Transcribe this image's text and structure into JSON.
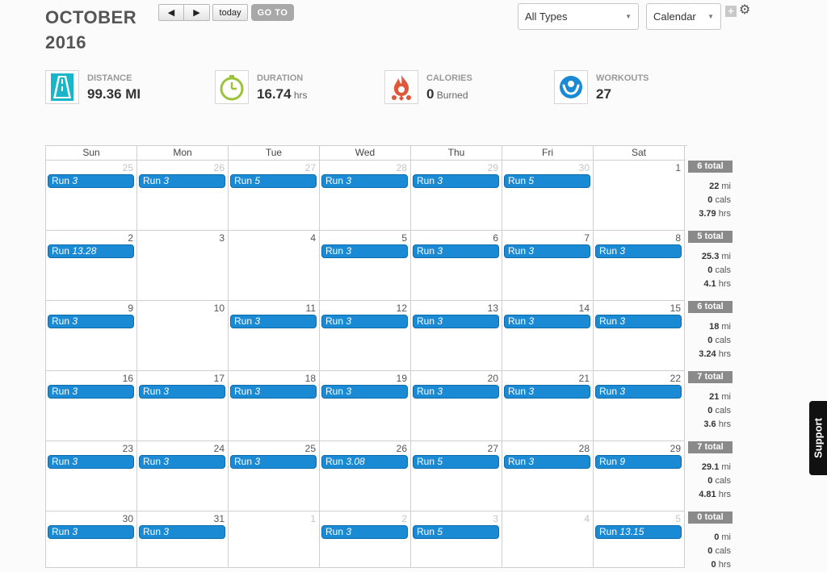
{
  "header": {
    "month": "OCTOBER",
    "year": "2016",
    "prev_label": "◀",
    "next_label": "▶",
    "today_label": "today",
    "goto_label": "GO TO",
    "types_select": "All Types",
    "view_select": "Calendar",
    "plus_icon": "plus-icon",
    "settings_icon": "gear-icon"
  },
  "stats": [
    {
      "label": "DISTANCE",
      "value": "99.36 MI",
      "unit": "",
      "icon": "road-icon",
      "color": "#1ab5c8"
    },
    {
      "label": "DURATION",
      "value": "16.74",
      "unit": " hrs",
      "icon": "stopwatch-icon",
      "color": "#9bc43a"
    },
    {
      "label": "CALORIES",
      "value": "0",
      "unit": " Burned",
      "icon": "flame-icon",
      "color": "#e0583a"
    },
    {
      "label": "WORKOUTS",
      "value": "27",
      "unit": "",
      "icon": "person-icon",
      "color": "#1a8ad4"
    }
  ],
  "calendar": {
    "days_of_week": [
      "Sun",
      "Mon",
      "Tue",
      "Wed",
      "Thu",
      "Fri",
      "Sat"
    ],
    "event_color": "#1a8ad4",
    "weeks": [
      {
        "days": [
          {
            "num": "25",
            "other": true,
            "event": {
              "type": "Run",
              "value": "3"
            }
          },
          {
            "num": "26",
            "other": true,
            "event": {
              "type": "Run",
              "value": "3"
            }
          },
          {
            "num": "27",
            "other": true,
            "event": {
              "type": "Run",
              "value": "5"
            }
          },
          {
            "num": "28",
            "other": true,
            "event": {
              "type": "Run",
              "value": "3"
            }
          },
          {
            "num": "29",
            "other": true,
            "event": {
              "type": "Run",
              "value": "3"
            }
          },
          {
            "num": "30",
            "other": true,
            "event": {
              "type": "Run",
              "value": "5"
            }
          },
          {
            "num": "1",
            "other": false,
            "event": null
          }
        ],
        "totals": {
          "count": "6 total",
          "mi": "22",
          "cals": "0",
          "hrs": "3.79"
        }
      },
      {
        "days": [
          {
            "num": "2",
            "other": false,
            "event": {
              "type": "Run",
              "value": "13.28"
            }
          },
          {
            "num": "3",
            "other": false,
            "event": null
          },
          {
            "num": "4",
            "other": false,
            "event": null
          },
          {
            "num": "5",
            "other": false,
            "event": {
              "type": "Run",
              "value": "3"
            }
          },
          {
            "num": "6",
            "other": false,
            "event": {
              "type": "Run",
              "value": "3"
            }
          },
          {
            "num": "7",
            "other": false,
            "event": {
              "type": "Run",
              "value": "3"
            }
          },
          {
            "num": "8",
            "other": false,
            "event": {
              "type": "Run",
              "value": "3"
            }
          }
        ],
        "totals": {
          "count": "5 total",
          "mi": "25.3",
          "cals": "0",
          "hrs": "4.1"
        }
      },
      {
        "days": [
          {
            "num": "9",
            "other": false,
            "event": {
              "type": "Run",
              "value": "3"
            }
          },
          {
            "num": "10",
            "other": false,
            "event": null
          },
          {
            "num": "11",
            "other": false,
            "event": {
              "type": "Run",
              "value": "3"
            }
          },
          {
            "num": "12",
            "other": false,
            "event": {
              "type": "Run",
              "value": "3"
            }
          },
          {
            "num": "13",
            "other": false,
            "event": {
              "type": "Run",
              "value": "3"
            }
          },
          {
            "num": "14",
            "other": false,
            "event": {
              "type": "Run",
              "value": "3"
            }
          },
          {
            "num": "15",
            "other": false,
            "event": {
              "type": "Run",
              "value": "3"
            }
          }
        ],
        "totals": {
          "count": "6 total",
          "mi": "18",
          "cals": "0",
          "hrs": "3.24"
        }
      },
      {
        "days": [
          {
            "num": "16",
            "other": false,
            "event": {
              "type": "Run",
              "value": "3"
            }
          },
          {
            "num": "17",
            "other": false,
            "event": {
              "type": "Run",
              "value": "3"
            }
          },
          {
            "num": "18",
            "other": false,
            "event": {
              "type": "Run",
              "value": "3"
            }
          },
          {
            "num": "19",
            "other": false,
            "event": {
              "type": "Run",
              "value": "3"
            }
          },
          {
            "num": "20",
            "other": false,
            "event": {
              "type": "Run",
              "value": "3"
            }
          },
          {
            "num": "21",
            "other": false,
            "event": {
              "type": "Run",
              "value": "3"
            }
          },
          {
            "num": "22",
            "other": false,
            "event": {
              "type": "Run",
              "value": "3"
            }
          }
        ],
        "totals": {
          "count": "7 total",
          "mi": "21",
          "cals": "0",
          "hrs": "3.6"
        }
      },
      {
        "days": [
          {
            "num": "23",
            "other": false,
            "event": {
              "type": "Run",
              "value": "3"
            }
          },
          {
            "num": "24",
            "other": false,
            "event": {
              "type": "Run",
              "value": "3"
            }
          },
          {
            "num": "25",
            "other": false,
            "event": {
              "type": "Run",
              "value": "3"
            }
          },
          {
            "num": "26",
            "other": false,
            "event": {
              "type": "Run",
              "value": "3.08"
            }
          },
          {
            "num": "27",
            "other": false,
            "event": {
              "type": "Run",
              "value": "5"
            }
          },
          {
            "num": "28",
            "other": false,
            "event": {
              "type": "Run",
              "value": "3"
            }
          },
          {
            "num": "29",
            "other": false,
            "event": {
              "type": "Run",
              "value": "9"
            }
          }
        ],
        "totals": {
          "count": "7 total",
          "mi": "29.1",
          "cals": "0",
          "hrs": "4.81"
        }
      },
      {
        "days": [
          {
            "num": "30",
            "other": false,
            "event": {
              "type": "Run",
              "value": "3"
            }
          },
          {
            "num": "31",
            "other": false,
            "event": {
              "type": "Run",
              "value": "3"
            }
          },
          {
            "num": "1",
            "other": true,
            "event": null
          },
          {
            "num": "2",
            "other": true,
            "event": {
              "type": "Run",
              "value": "3"
            }
          },
          {
            "num": "3",
            "other": true,
            "event": {
              "type": "Run",
              "value": "5"
            }
          },
          {
            "num": "4",
            "other": true,
            "event": null
          },
          {
            "num": "5",
            "other": true,
            "event": {
              "type": "Run",
              "value": "13.15"
            }
          }
        ],
        "totals": {
          "count": "0 total",
          "mi": "0",
          "cals": "0",
          "hrs": "0"
        }
      }
    ],
    "units": {
      "mi": "mi",
      "cals": "cals",
      "hrs": "hrs"
    }
  },
  "support_label": "Support"
}
